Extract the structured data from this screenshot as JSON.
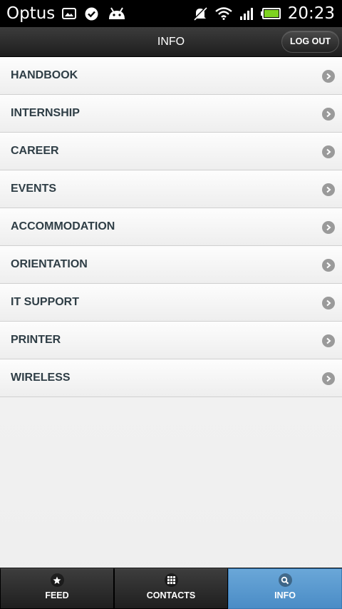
{
  "status_bar": {
    "carrier": "Optus",
    "time": "20:23",
    "icons": [
      "image-icon",
      "check-circle-icon",
      "android-icon",
      "muted-bell-icon",
      "wifi-icon",
      "signal-icon",
      "battery-icon"
    ],
    "battery_color": "#7ed321"
  },
  "header": {
    "title": "INFO",
    "logout_label": "LOG OUT"
  },
  "list": {
    "items": [
      {
        "label": "HANDBOOK"
      },
      {
        "label": "INTERNSHIP"
      },
      {
        "label": "CAREER"
      },
      {
        "label": "EVENTS"
      },
      {
        "label": "ACCOMMODATION"
      },
      {
        "label": "ORIENTATION"
      },
      {
        "label": "IT SUPPORT"
      },
      {
        "label": "PRINTER"
      },
      {
        "label": "WIRELESS"
      }
    ]
  },
  "tabbar": {
    "tabs": [
      {
        "label": "FEED",
        "icon": "star-icon",
        "active": false
      },
      {
        "label": "CONTACTS",
        "icon": "grid-icon",
        "active": false
      },
      {
        "label": "INFO",
        "icon": "search-icon",
        "active": true
      }
    ],
    "active_color": "#5b9bd0"
  }
}
